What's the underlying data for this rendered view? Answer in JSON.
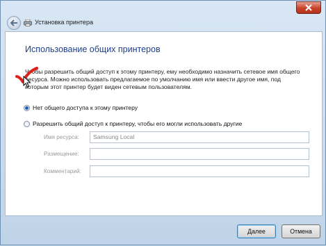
{
  "window": {
    "title": "Установка принтера"
  },
  "page": {
    "heading": "Использование общих принтеров",
    "description": "Чтобы разрешить общий доступ к этому принтеру, ему необходимо назначить сетевое имя общего ресурса. Можно использовать предлагаемое по умолчанию имя или ввести другое имя, под которым этот принтер будет виден сетевым пользователям."
  },
  "options": [
    {
      "label": "Нет общего доступа к этому принтеру",
      "selected": true
    },
    {
      "label": "Разрешить общий доступ к принтеру, чтобы его могли использовать другие",
      "selected": false
    }
  ],
  "fields": {
    "share_name": {
      "label": "Имя ресурса:",
      "value": "Samsung Local",
      "enabled": false
    },
    "location": {
      "label": "Размещение:",
      "value": "",
      "enabled": false
    },
    "comment": {
      "label": "Комментарий:",
      "value": "",
      "enabled": false
    }
  },
  "buttons": {
    "next": "Далее",
    "cancel": "Отмена"
  },
  "icons": {
    "close": "close-icon",
    "back": "back-arrow-icon",
    "printer": "printer-icon",
    "annotation": "red-checkmark-icon",
    "cursor": "mouse-cursor-icon"
  },
  "colors": {
    "heading": "#1f3f8c",
    "close_button": "#c7432b",
    "annotation_check": "#e0201b"
  }
}
